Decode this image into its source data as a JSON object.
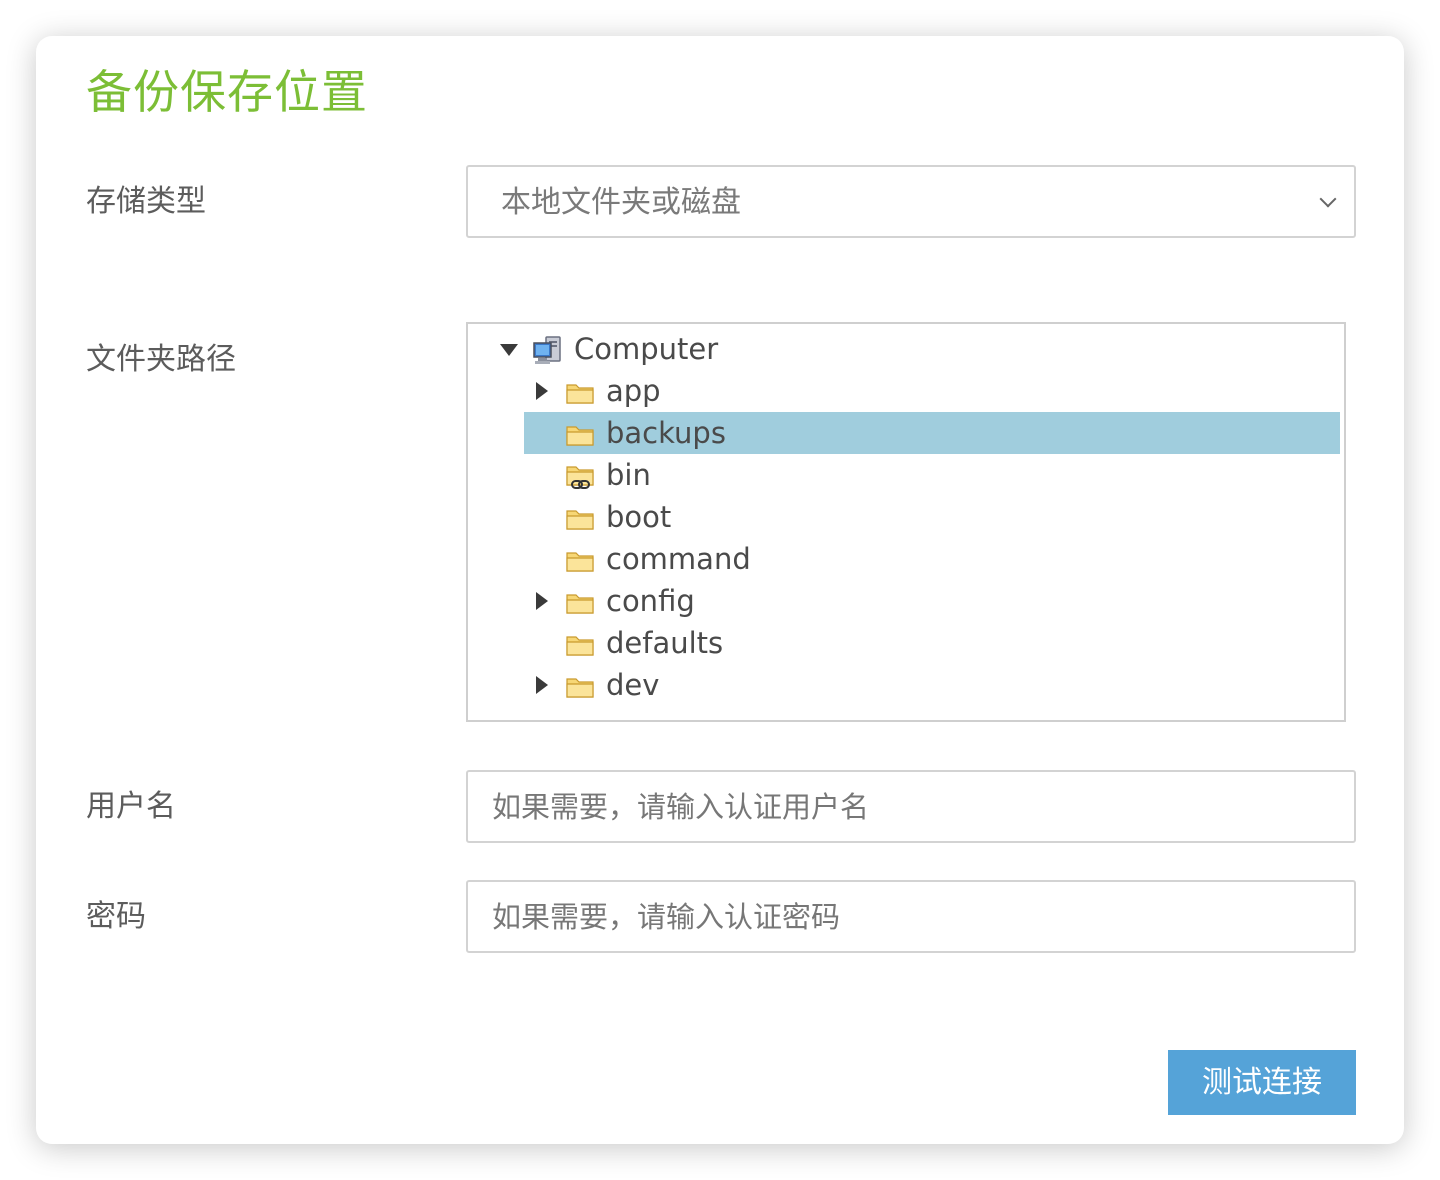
{
  "page_title": "备份保存位置",
  "storage_type": {
    "label": "存储类型",
    "selected": "本地文件夹或磁盘"
  },
  "folder_path": {
    "label": "文件夹路径",
    "tree": {
      "root": {
        "label": "Computer",
        "icon": "computer-icon",
        "expanded": true
      },
      "items": [
        {
          "label": "app",
          "icon": "folder-icon",
          "expandable": true,
          "selected": false
        },
        {
          "label": "backups",
          "icon": "folder-icon",
          "expandable": false,
          "selected": true
        },
        {
          "label": "bin",
          "icon": "folder-link-icon",
          "expandable": false,
          "selected": false
        },
        {
          "label": "boot",
          "icon": "folder-icon",
          "expandable": false,
          "selected": false
        },
        {
          "label": "command",
          "icon": "folder-icon",
          "expandable": false,
          "selected": false
        },
        {
          "label": "config",
          "icon": "folder-icon",
          "expandable": true,
          "selected": false
        },
        {
          "label": "defaults",
          "icon": "folder-icon",
          "expandable": false,
          "selected": false
        },
        {
          "label": "dev",
          "icon": "folder-icon",
          "expandable": true,
          "selected": false
        }
      ]
    }
  },
  "username": {
    "label": "用户名",
    "placeholder": "如果需要，请输入认证用户名",
    "value": ""
  },
  "password": {
    "label": "密码",
    "placeholder": "如果需要，请输入认证密码",
    "value": ""
  },
  "test_connection_button": "测试连接",
  "colors": {
    "title": "#7cbe36",
    "selected_row": "#a0cddd",
    "button": "#55a3d8"
  }
}
